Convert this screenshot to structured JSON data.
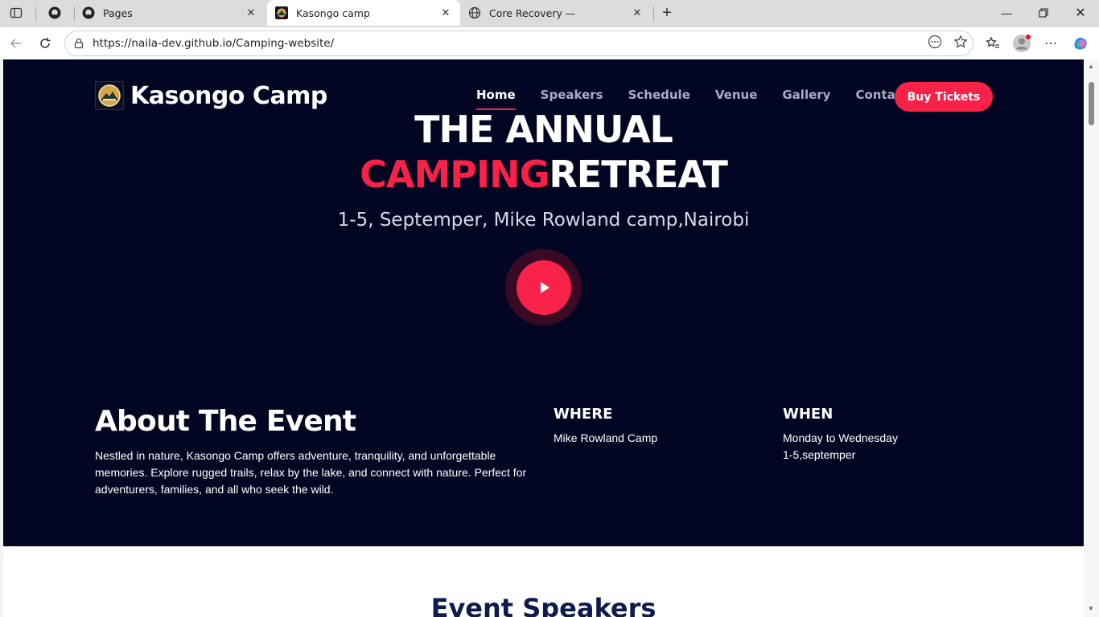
{
  "browser": {
    "tabs": [
      {
        "title": "",
        "icon": "github-icon"
      },
      {
        "title": "Pages",
        "icon": "github-icon"
      },
      {
        "title": "Kasongo camp",
        "icon": "camp-logo-icon"
      },
      {
        "title": "Core Recovery —",
        "icon": "globe-icon"
      }
    ],
    "url": "https://naila-dev.github.io/Camping-website/"
  },
  "site": {
    "brand": "Kasongo Camp",
    "nav": [
      "Home",
      "Speakers",
      "Schedule",
      "Venue",
      "Gallery",
      "Contact"
    ],
    "buy_label": "Buy Tickets",
    "hero": {
      "line1": "THE ANNUAL",
      "line2_accent": "CAMPING",
      "line2_rest": "RETREAT",
      "subtitle": "1-5, Septemper, Mike Rowland camp,Nairobi"
    },
    "about": {
      "title": "About The Event",
      "text": "Nestled in nature, Kasongo Camp offers adventure, tranquility, and unforgettable memories. Explore rugged trails, relax by the lake, and connect with nature. Perfect for adventurers, families, and all who seek the wild.",
      "where_label": "WHERE",
      "where_value": "Mike Rowland Camp",
      "when_label": "WHEN",
      "when_line1": "Monday to Wednesday",
      "when_line2": "1-5,septemper"
    },
    "speakers_title": "Event Speakers"
  },
  "colors": {
    "accent": "#f82249",
    "hero_bg": "#030622",
    "heading_dark": "#0e1b4d"
  }
}
